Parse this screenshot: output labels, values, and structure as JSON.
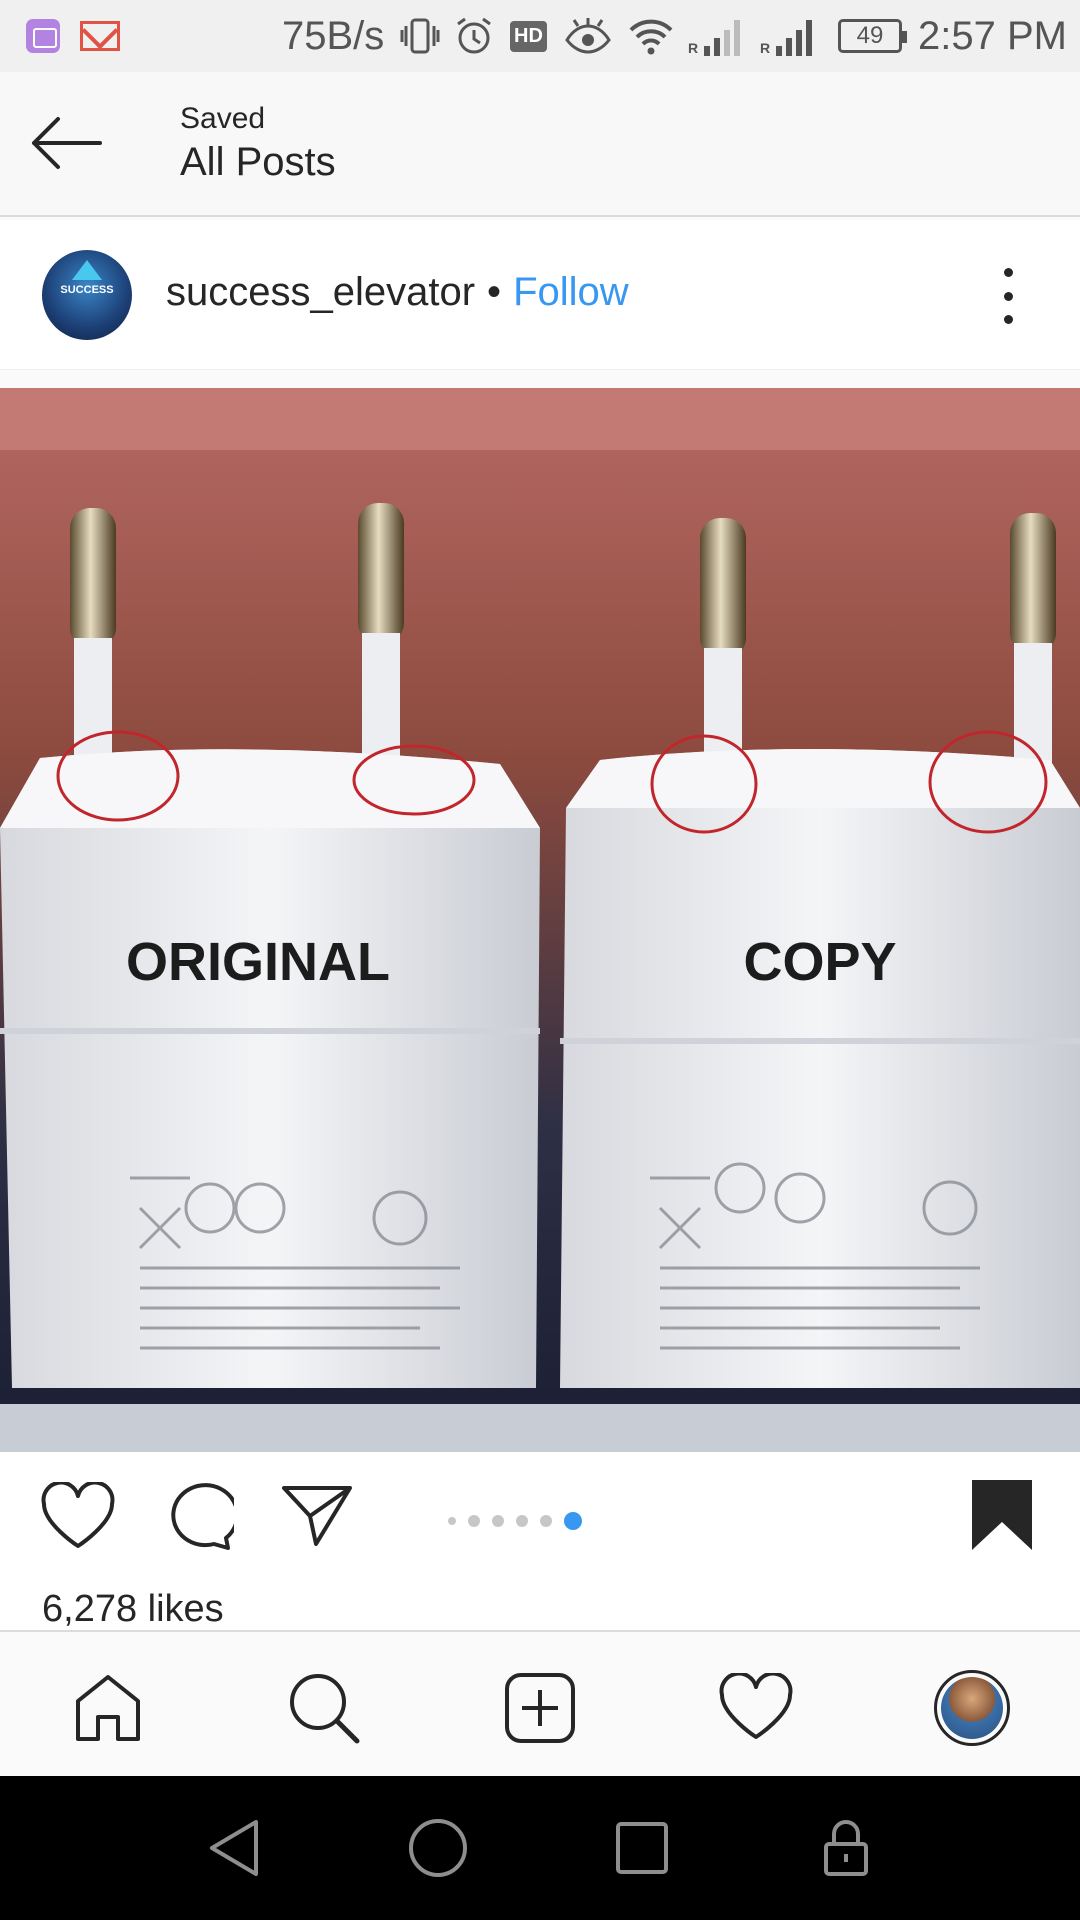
{
  "status_bar": {
    "net_speed": "75B/s",
    "hd_label": "HD",
    "battery": "49",
    "time": "2:57 PM",
    "signal_label": "R"
  },
  "header": {
    "subtitle": "Saved",
    "title": "All Posts"
  },
  "post": {
    "username": "success_elevator",
    "separator": "•",
    "follow_label": "Follow",
    "avatar_text": "SUCCESS",
    "image_labels": {
      "left": "ORIGINAL",
      "right": "COPY"
    },
    "carousel": {
      "count": 6,
      "active_index": 5
    },
    "likes": "6,278 likes"
  },
  "colors": {
    "accent": "#3897f0",
    "text": "#262626",
    "active_dot": "#3897f0"
  },
  "icons": {
    "back": "arrow-left-icon",
    "more": "more-vertical-icon",
    "like": "heart-icon",
    "comment": "comment-icon",
    "share": "send-icon",
    "save": "bookmark-filled-icon",
    "home": "home-icon",
    "search": "search-icon",
    "new_post": "plus-square-icon",
    "activity": "heart-icon",
    "profile": "profile-avatar"
  }
}
